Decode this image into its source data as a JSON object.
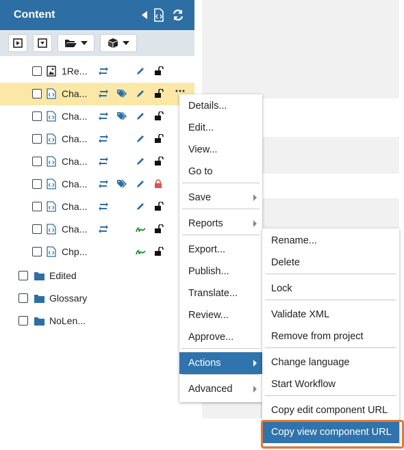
{
  "panel": {
    "title": "Content",
    "header_icons": [
      "collapse-left-icon",
      "xml-document-icon",
      "refresh-icon"
    ]
  },
  "toolbar": {
    "buttons": [
      "play-icon",
      "dropdown-box-icon",
      "folder-open-icon",
      "cube-icon"
    ]
  },
  "tree": {
    "files": [
      {
        "name": "1Re...",
        "type": "image"
      },
      {
        "name": "Cha...",
        "type": "xml"
      },
      {
        "name": "Cha...",
        "type": "xml"
      },
      {
        "name": "Cha...",
        "type": "xml"
      },
      {
        "name": "Cha...",
        "type": "xml"
      },
      {
        "name": "Cha...",
        "type": "xml"
      },
      {
        "name": "Cha...",
        "type": "xml"
      },
      {
        "name": "Cha...",
        "type": "xml"
      },
      {
        "name": "Chp...",
        "type": "xml"
      }
    ],
    "folders": [
      {
        "name": "Edited"
      },
      {
        "name": "Glossary"
      },
      {
        "name": "NoLen..."
      }
    ]
  },
  "context_menu": {
    "items": [
      "Details...",
      "Edit...",
      "View...",
      "Go to",
      "Save",
      "Reports",
      "Export...",
      "Publish...",
      "Translate...",
      "Review...",
      "Approve...",
      "Actions",
      "Advanced"
    ],
    "active": "Actions"
  },
  "submenu": {
    "items": [
      "Rename...",
      "Delete",
      "Lock",
      "Validate XML",
      "Remove from project",
      "Change language",
      "Start Workflow",
      "Copy edit component URL",
      "Copy view component URL"
    ],
    "active": "Copy view component URL"
  },
  "colors": {
    "header": "#2d6fa5",
    "selected_row": "#fbe7a6",
    "menu_active": "#2f74ad",
    "highlight": "#e8772e"
  }
}
